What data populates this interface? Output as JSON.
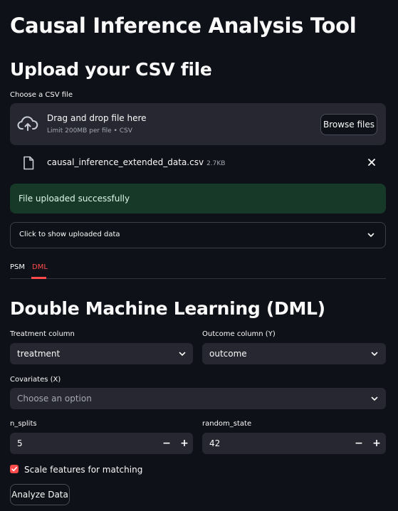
{
  "app": {
    "title": "Causal Inference Analysis Tool"
  },
  "upload": {
    "heading": "Upload your CSV file",
    "label": "Choose a CSV file",
    "dropzone_text": "Drag and drop file here",
    "dropzone_subtext": "Limit 200MB per file • CSV",
    "browse_label": "Browse files",
    "file_name": "causal_inference_extended_data.csv",
    "file_size": "2.7KB",
    "success_message": "File uploaded successfully",
    "expander_label": "Click to show uploaded data"
  },
  "tabs": [
    {
      "label": "PSM",
      "active": false
    },
    {
      "label": "DML",
      "active": true
    }
  ],
  "dml": {
    "heading": "Double Machine Learning (DML)",
    "treatment_label": "Treatment column",
    "treatment_value": "treatment",
    "outcome_label": "Outcome column (Y)",
    "outcome_value": "outcome",
    "covariates_label": "Covariates (X)",
    "covariates_placeholder": "Choose an option",
    "n_splits_label": "n_splits",
    "n_splits_value": "5",
    "random_state_label": "random_state",
    "random_state_value": "42",
    "minus": "−",
    "plus": "+",
    "scale_label": "Scale features for matching",
    "scale_checked": true,
    "analyze_label": "Analyze Data"
  },
  "colors": {
    "background": "#0e1117",
    "accent": "#ff4b4b",
    "success_bg": "#173928",
    "input_bg": "#262730"
  }
}
